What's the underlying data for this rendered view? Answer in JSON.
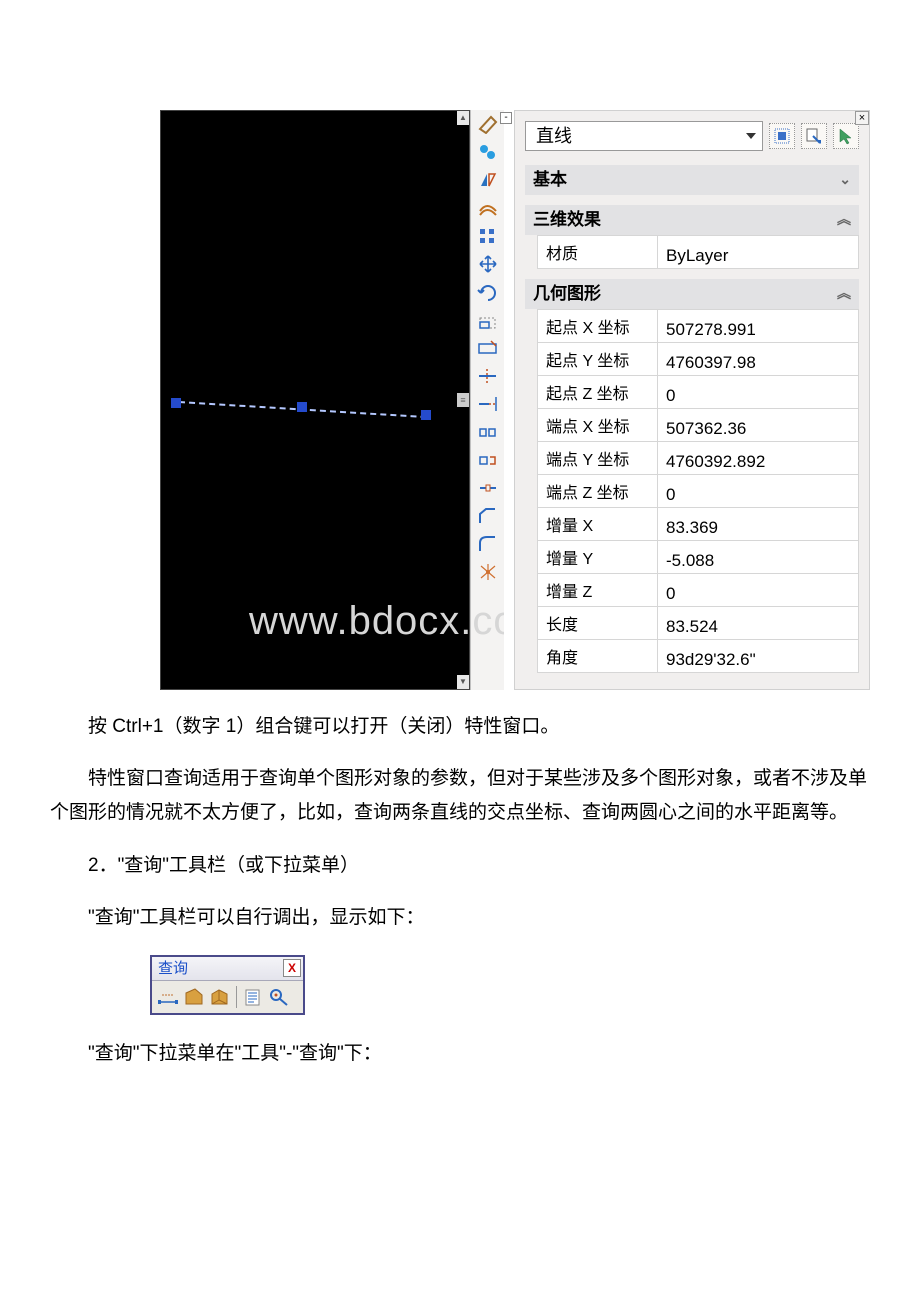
{
  "properties_panel": {
    "selected_object": "直线",
    "sections": {
      "basic": {
        "title": "基本"
      },
      "threeD": {
        "title": "三维效果",
        "rows": [
          {
            "label": "材质",
            "value": "ByLayer"
          }
        ]
      },
      "geometry": {
        "title": "几何图形",
        "rows": [
          {
            "label": "起点 X 坐标",
            "value": "507278.991"
          },
          {
            "label": "起点 Y 坐标",
            "value": "4760397.98"
          },
          {
            "label": "起点 Z 坐标",
            "value": "0"
          },
          {
            "label": "端点 X 坐标",
            "value": "507362.36"
          },
          {
            "label": "端点 Y 坐标",
            "value": "4760392.892"
          },
          {
            "label": "端点 Z 坐标",
            "value": "0"
          },
          {
            "label": "增量 X",
            "value": "83.369"
          },
          {
            "label": "增量 Y",
            "value": "-5.088"
          },
          {
            "label": "增量 Z",
            "value": "0"
          },
          {
            "label": "长度",
            "value": "83.524"
          },
          {
            "label": "角度",
            "value": "93d29'32.6\""
          }
        ]
      }
    }
  },
  "watermark": "www.bdocx.com",
  "paragraphs": {
    "p1": "按 Ctrl+1（数字 1）组合键可以打开（关闭）特性窗口。",
    "p2": "特性窗口查询适用于查询单个图形对象的参数，但对于某些涉及多个图形对象，或者不涉及单个图形的情况就不太方便了，比如，查询两条直线的交点坐标、查询两圆心之间的水平距离等。",
    "p3": "2．\"查询\"工具栏（或下拉菜单）",
    "p4": "\"查询\"工具栏可以自行调出，显示如下：",
    "p5": "\"查询\"下拉菜单在\"工具\"-\"查询\"下："
  },
  "query_toolbar": {
    "title": "查询"
  }
}
